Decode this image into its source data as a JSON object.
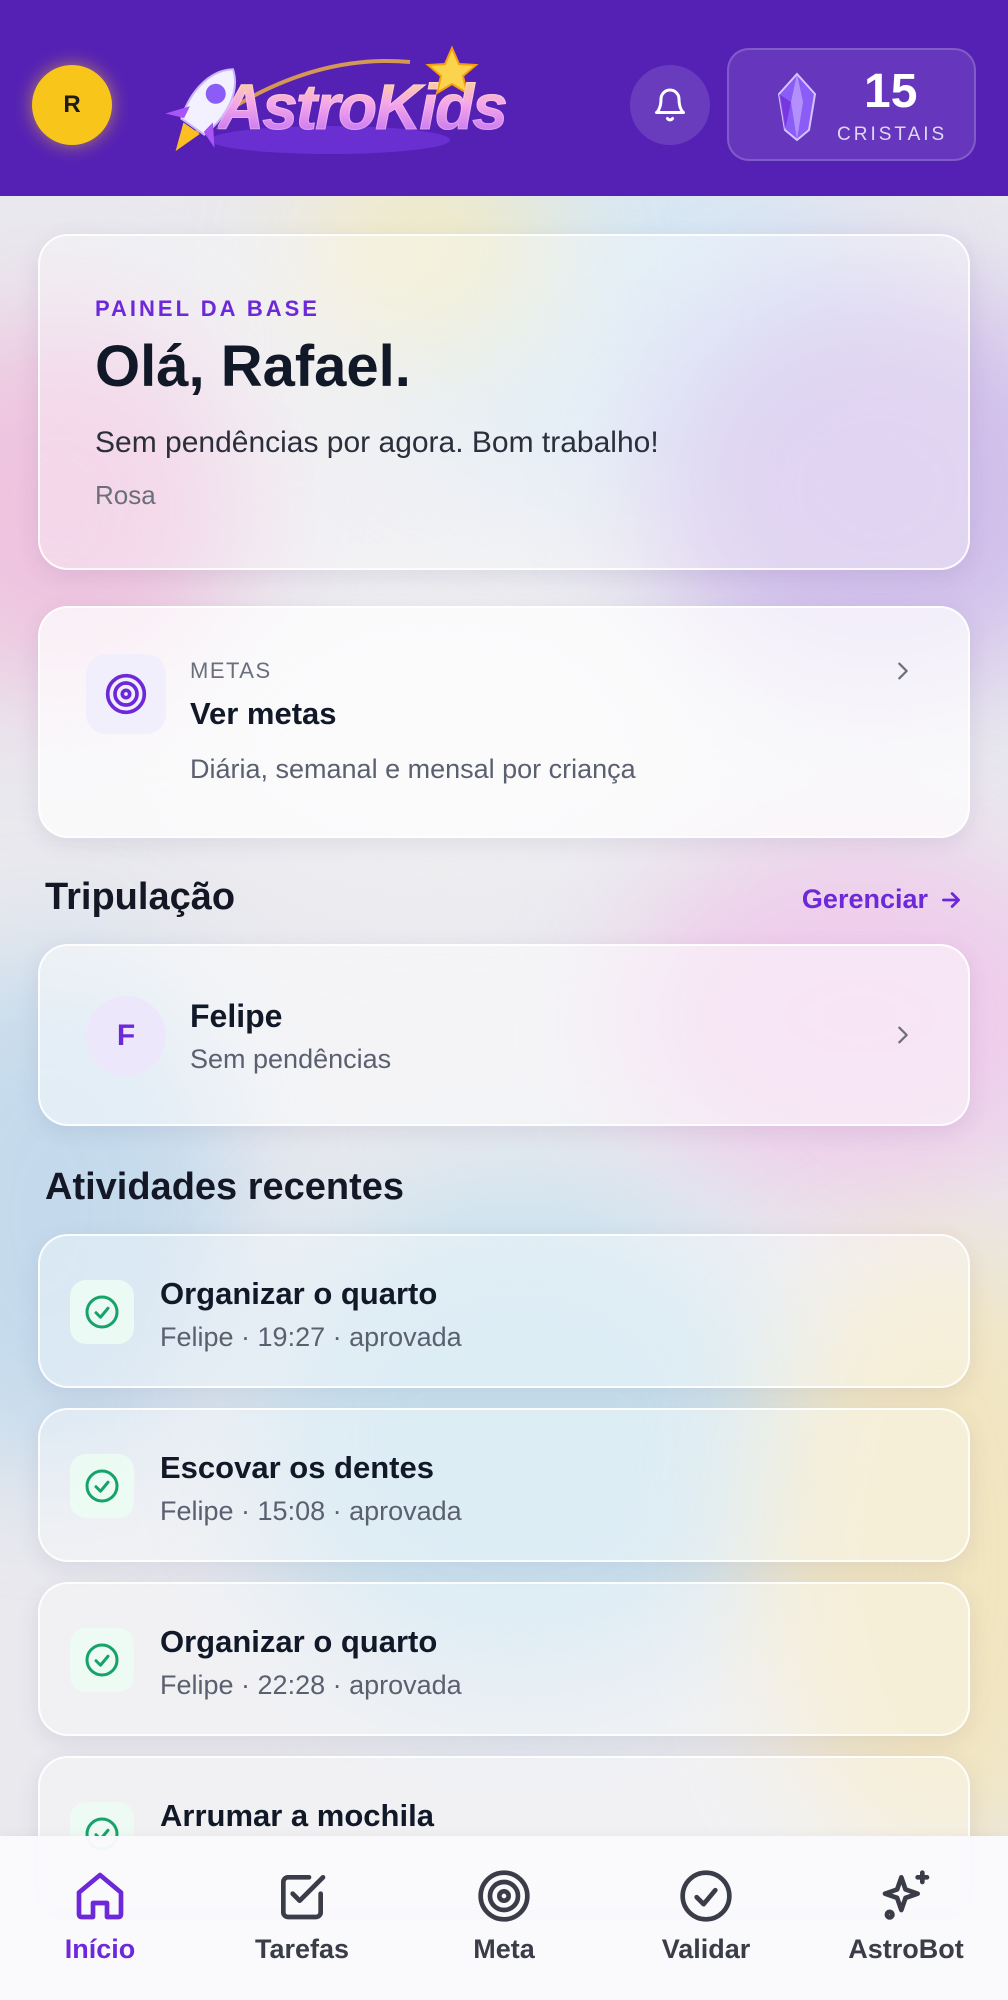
{
  "header": {
    "avatar_initial": "R",
    "logo_text": "AstroKids",
    "crystals": {
      "count": "15",
      "label": "CRISTAIS"
    }
  },
  "welcome": {
    "eyebrow": "PAINEL DA BASE",
    "title": "Olá, Rafael.",
    "subtitle": "Sem pendências por agora. Bom trabalho!",
    "meta": "Rosa"
  },
  "goals": {
    "kicker": "METAS",
    "title": "Ver metas",
    "description": "Diária, semanal e mensal por criança"
  },
  "crew": {
    "heading": "Tripulação",
    "manage_label": "Gerenciar",
    "members": [
      {
        "initial": "F",
        "name": "Felipe",
        "status": "Sem pendências"
      }
    ]
  },
  "recent": {
    "heading": "Atividades recentes",
    "items": [
      {
        "title": "Organizar o quarto",
        "subtitle": "Felipe · 19:27 · aprovada"
      },
      {
        "title": "Escovar os dentes",
        "subtitle": "Felipe · 15:08 · aprovada"
      },
      {
        "title": "Organizar o quarto",
        "subtitle": "Felipe · 22:28 · aprovada"
      },
      {
        "title": "Arrumar a mochila",
        "subtitle": ""
      }
    ]
  },
  "nav": {
    "items": [
      {
        "label": "Início",
        "icon": "home-icon",
        "active": true
      },
      {
        "label": "Tarefas",
        "icon": "checkbox-icon",
        "active": false
      },
      {
        "label": "Meta",
        "icon": "target-icon",
        "active": false
      },
      {
        "label": "Validar",
        "icon": "check-circle-icon",
        "active": false
      },
      {
        "label": "AstroBot",
        "icon": "sparkles-icon",
        "active": false
      }
    ]
  },
  "colors": {
    "header_bg": "#5521b5",
    "accent": "#6d28d9",
    "avatar_bg": "#f8c51a",
    "success": "#16a36a"
  }
}
